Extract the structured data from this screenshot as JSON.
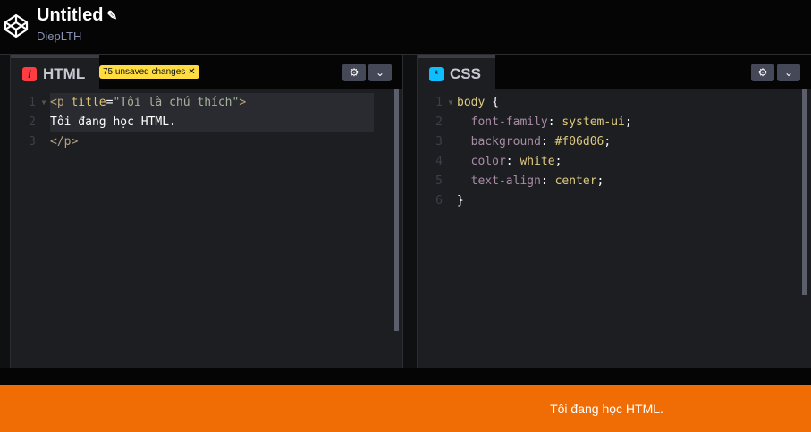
{
  "header": {
    "title": "Untitled",
    "user": "DiepLTH"
  },
  "html_panel": {
    "tab": "HTML",
    "icon": "/",
    "badge": "75 unsaved changes",
    "lines": [
      {
        "n": "1",
        "parts": [
          [
            "tag",
            "<p "
          ],
          [
            "attr",
            "title"
          ],
          [
            "punc",
            "="
          ],
          [
            "str",
            "\"Tôi là chú thích\""
          ],
          [
            "tag",
            ">"
          ]
        ]
      },
      {
        "n": "2",
        "parts": [
          [
            "txt",
            "Tôi đang học HTML."
          ]
        ]
      },
      {
        "n": "3",
        "parts": [
          [
            "tag",
            "</p>"
          ]
        ]
      }
    ]
  },
  "css_panel": {
    "tab": "CSS",
    "icon": "*",
    "lines": [
      {
        "n": "1",
        "parts": [
          [
            "val",
            "body "
          ],
          [
            "punc",
            "{"
          ]
        ]
      },
      {
        "n": "2",
        "parts": [
          [
            "prop",
            "  font-family"
          ],
          [
            "punc",
            ": "
          ],
          [
            "val",
            "system-ui"
          ],
          [
            "punc",
            ";"
          ]
        ]
      },
      {
        "n": "3",
        "parts": [
          [
            "prop",
            "  background"
          ],
          [
            "punc",
            ": "
          ],
          [
            "val",
            "#f06d06"
          ],
          [
            "punc",
            ";"
          ]
        ]
      },
      {
        "n": "4",
        "parts": [
          [
            "prop",
            "  color"
          ],
          [
            "punc",
            ": "
          ],
          [
            "val",
            "white"
          ],
          [
            "punc",
            ";"
          ]
        ]
      },
      {
        "n": "5",
        "parts": [
          [
            "prop",
            "  text-align"
          ],
          [
            "punc",
            ": "
          ],
          [
            "val",
            "center"
          ],
          [
            "punc",
            ";"
          ]
        ]
      },
      {
        "n": "6",
        "parts": [
          [
            "punc",
            "}"
          ]
        ]
      }
    ]
  },
  "output": {
    "text": "Tôi đang học HTML."
  },
  "colors": {
    "output_bg": "#f06d06",
    "html_icon": "#ff3c41",
    "css_icon": "#0ebeff",
    "badge": "#ffdd40"
  }
}
